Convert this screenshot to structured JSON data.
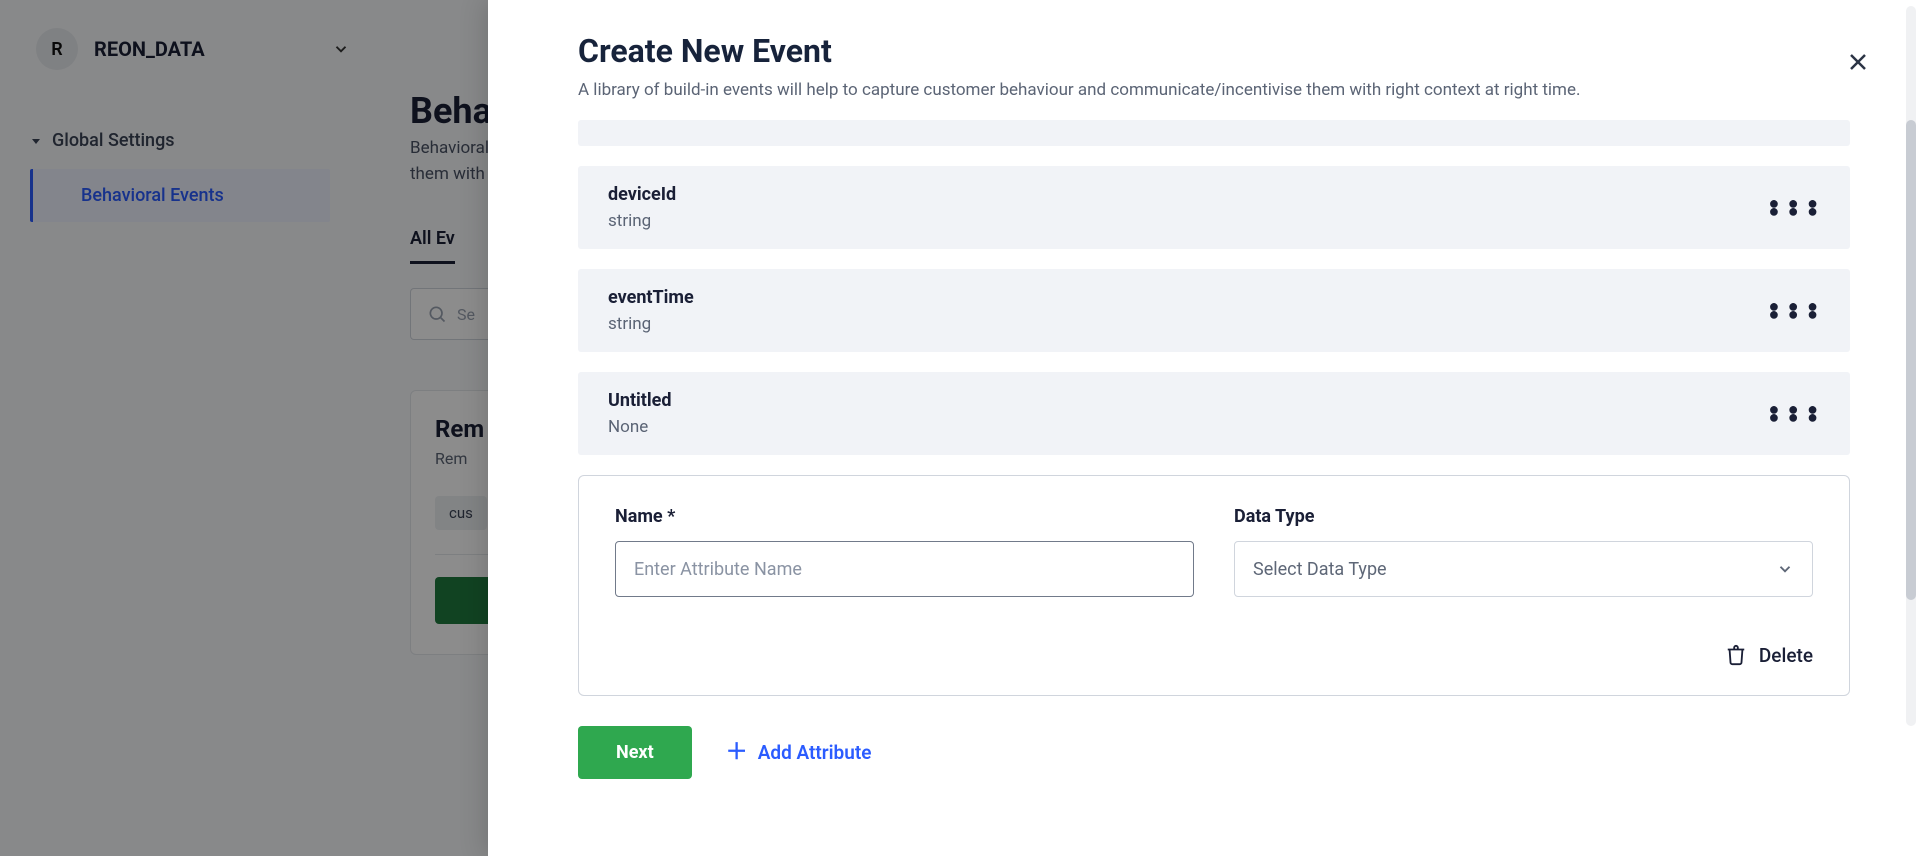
{
  "workspace": {
    "initial": "R",
    "name": "REON_DATA"
  },
  "sidebar": {
    "group_label": "Global Settings",
    "active_item": "Behavioral Events"
  },
  "page": {
    "title_visible": "Behav",
    "subtitle_visible": "Behavioral",
    "subtitle_line2_visible": "them with"
  },
  "tabs": {
    "active": "All Ev"
  },
  "search": {
    "placeholder_visible": "Se"
  },
  "card": {
    "title_visible": "Rem",
    "subtitle_visible": "Rem",
    "chip_visible": "cus"
  },
  "modal": {
    "title": "Create New Event",
    "subtitle": "A library of build-in events will help to capture customer behaviour and communicate/incentivise them with right context at right time.",
    "attributes": [
      {
        "name": "deviceId",
        "type": "string"
      },
      {
        "name": "eventTime",
        "type": "string"
      },
      {
        "name": "Untitled",
        "type": "None"
      }
    ],
    "edit": {
      "name_label": "Name *",
      "name_placeholder": "Enter Attribute Name",
      "name_value": "",
      "datatype_label": "Data Type",
      "datatype_placeholder": "Select Data Type",
      "delete_label": "Delete"
    },
    "footer": {
      "next_label": "Next",
      "add_label": "Add Attribute"
    }
  }
}
